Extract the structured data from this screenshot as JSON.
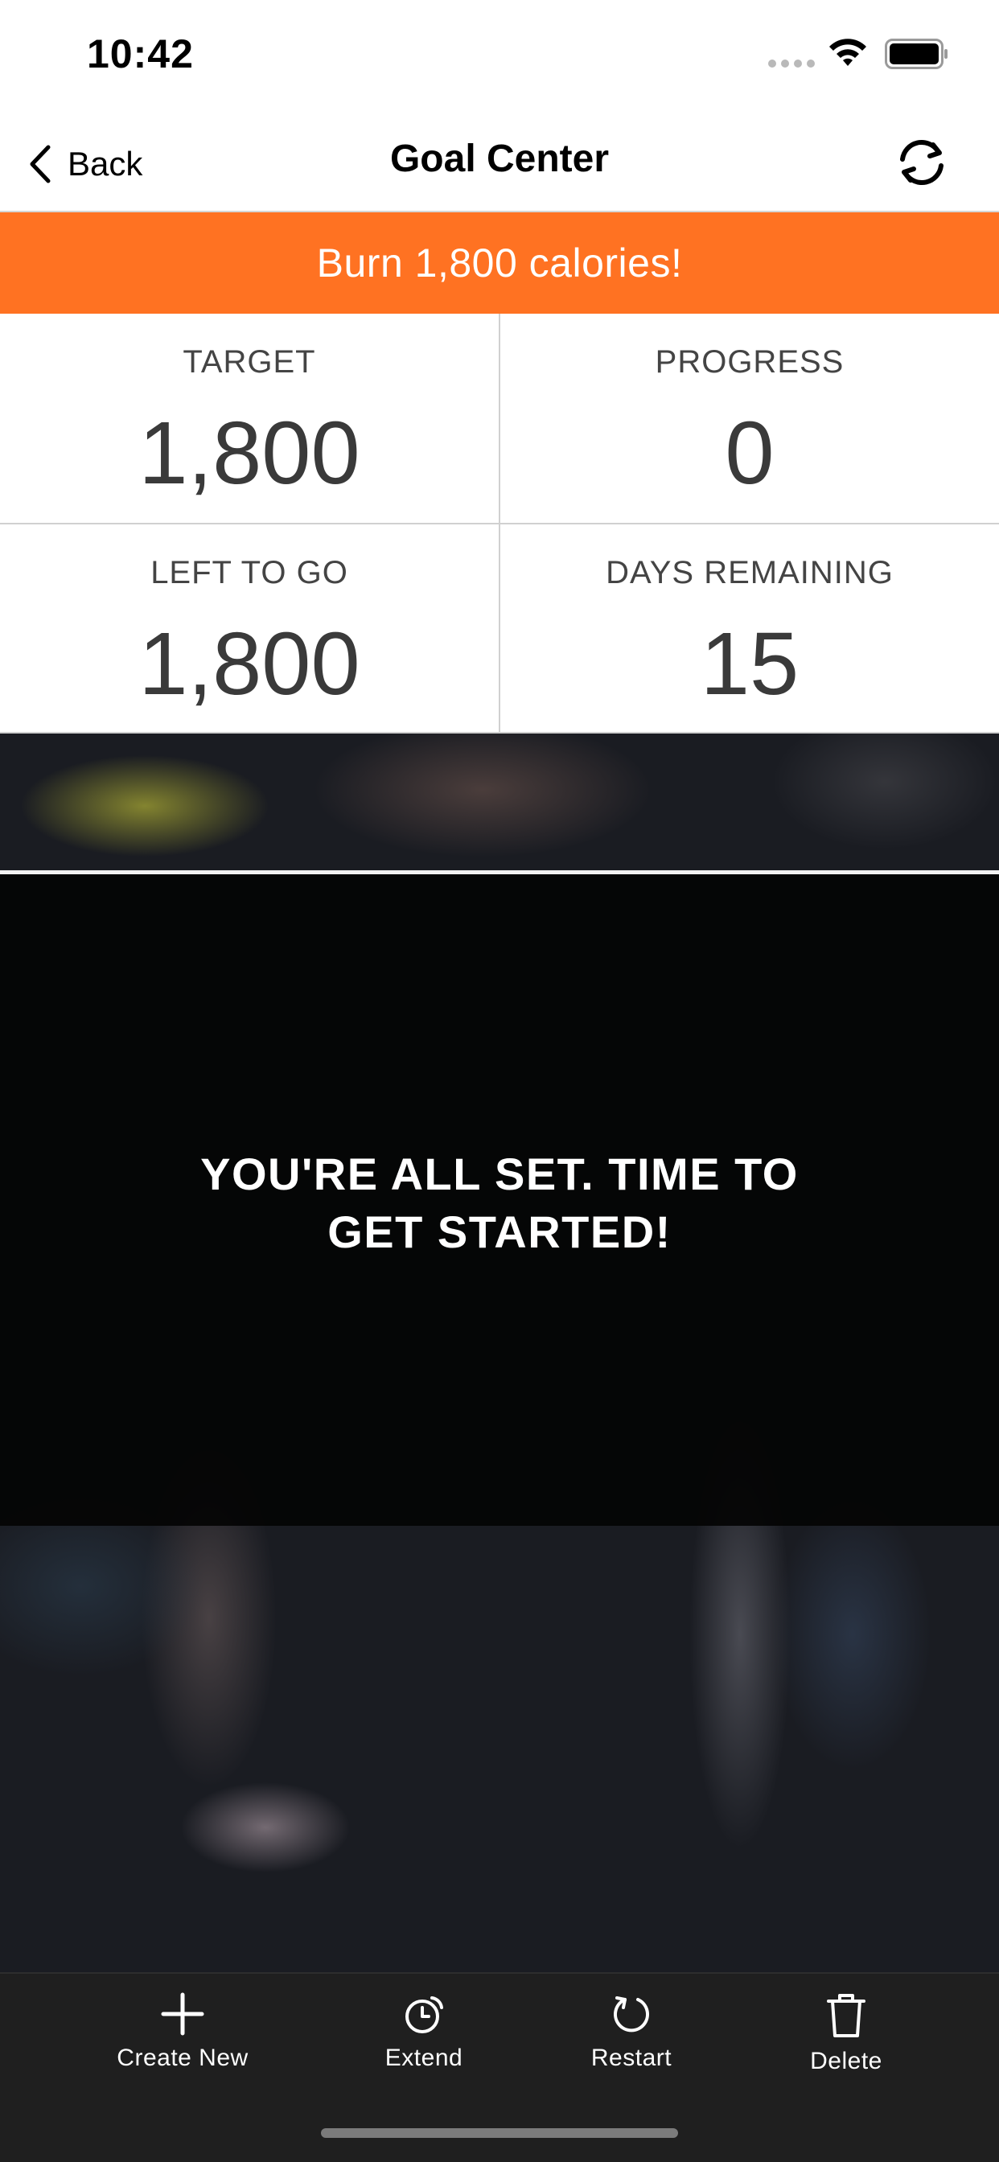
{
  "status_bar": {
    "time": "10:42"
  },
  "nav": {
    "back_label": "Back",
    "title": "Goal Center",
    "refresh_icon": "refresh-icon"
  },
  "goal_banner": {
    "text": "Burn 1,800 calories!",
    "color": "#ff7222"
  },
  "stats": [
    {
      "label": "TARGET",
      "value": "1,800"
    },
    {
      "label": "PROGRESS",
      "value": "0"
    },
    {
      "label": "LEFT TO GO",
      "value": "1,800"
    },
    {
      "label": "DAYS REMAINING",
      "value": "15"
    }
  ],
  "message": {
    "line1": "YOU'RE ALL SET. TIME TO",
    "line2": "GET STARTED!"
  },
  "toolbar": {
    "items": [
      {
        "label": "Create New",
        "icon": "plus-icon"
      },
      {
        "label": "Extend",
        "icon": "clock-icon"
      },
      {
        "label": "Restart",
        "icon": "restart-icon"
      },
      {
        "label": "Delete",
        "icon": "trash-icon"
      }
    ]
  }
}
